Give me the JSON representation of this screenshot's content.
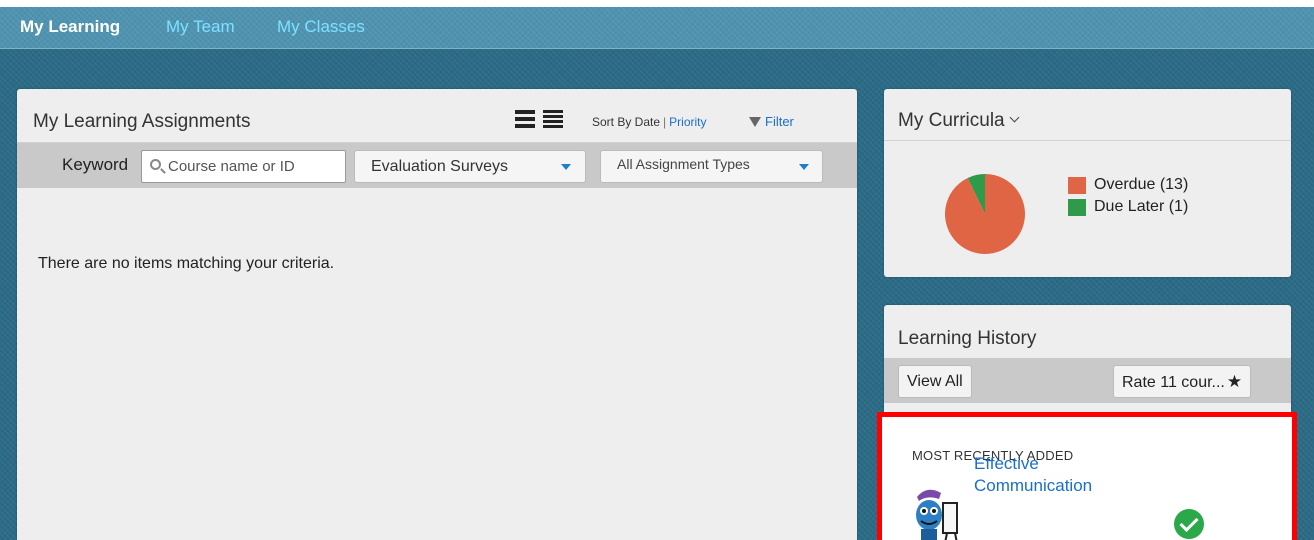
{
  "nav": {
    "tabs": [
      {
        "label": "My Learning",
        "active": true
      },
      {
        "label": "My Team",
        "active": false
      },
      {
        "label": "My Classes",
        "active": false
      }
    ]
  },
  "assignments": {
    "title": "My Learning Assignments",
    "sort_by": "Sort By Date",
    "sort_sep": "|",
    "sort_priority": "Priority",
    "filter": "Filter",
    "keyword_label": "Keyword",
    "keyword_placeholder": "Course name or ID",
    "dropdown1": "Evaluation Surveys",
    "dropdown2": "All Assignment Types",
    "empty_message": "There are no items matching your criteria."
  },
  "curricula": {
    "title": "My Curricula",
    "legend": [
      {
        "label": "Overdue (13)",
        "value": 13,
        "color": "#e06545"
      },
      {
        "label": "Due Later (1)",
        "value": 1,
        "color": "#2e9a4a"
      }
    ]
  },
  "history": {
    "title": "Learning History",
    "view_all": "View All",
    "rate_courses": "Rate 11 cour...",
    "rate_star": "★",
    "recent_label": "MOST RECENTLY ADDED",
    "course_title": "Effective Communication"
  },
  "colors": {
    "accent": "#1a6fc9",
    "highlight_border": "#ff0000",
    "check": "#2aa84a"
  }
}
